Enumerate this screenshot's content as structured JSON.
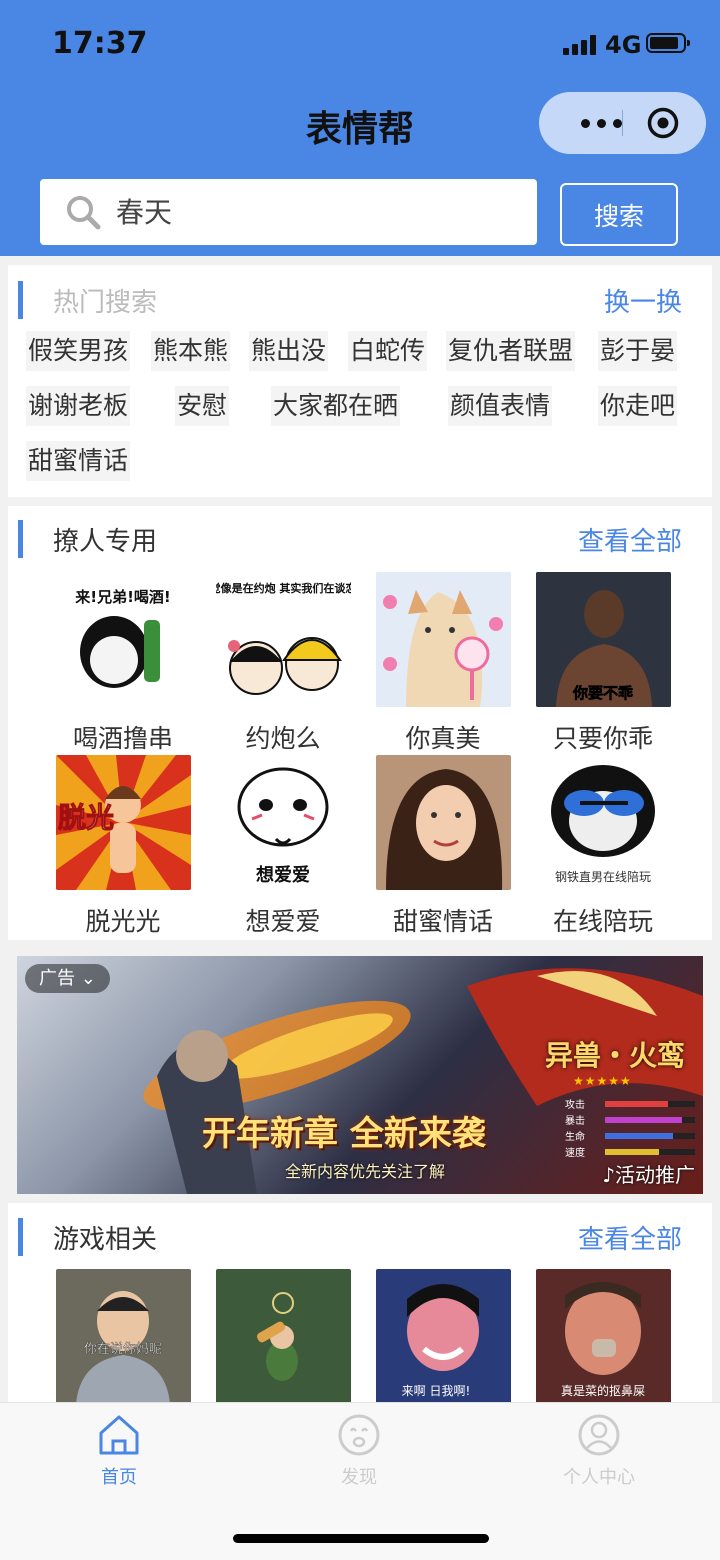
{
  "status_bar": {
    "time": "17:37",
    "network": "4G"
  },
  "app_title": "表情帮",
  "search": {
    "placeholder": "春天",
    "button_label": "搜索"
  },
  "hot_search": {
    "title": "热门搜索",
    "refresh_label": "换一换",
    "tags": [
      "假笑男孩",
      "熊本熊",
      "熊出没",
      "白蛇传",
      "复仇者联盟",
      "彭于晏",
      "谢谢老板",
      "安慰",
      "大家都在晒",
      "颜值表情",
      "你走吧",
      "甜蜜情话"
    ]
  },
  "flirt_section": {
    "title": "撩人专用",
    "view_all_label": "查看全部",
    "items": [
      {
        "label": "喝酒撸串",
        "overlay": "来!兄弟!喝酒!"
      },
      {
        "label": "约炮么",
        "overlay": "感觉像是在约炮 其实我们在谈恋爱"
      },
      {
        "label": "你真美",
        "overlay": ""
      },
      {
        "label": "只要你乖",
        "overlay": "你要不乖"
      },
      {
        "label": "脱光光",
        "overlay": "脱光"
      },
      {
        "label": "想爱爱",
        "overlay": "想爱爱"
      },
      {
        "label": "甜蜜情话",
        "overlay": ""
      },
      {
        "label": "在线陪玩",
        "overlay": "钢铁直男在线陪玩"
      }
    ]
  },
  "ad": {
    "badge": "广告",
    "headline": "开年新章 全新来袭",
    "subline": "全新内容优先关注了解",
    "game_name": "异兽・火鸾",
    "stars": "★★★★★",
    "stats": [
      {
        "label": "攻击",
        "level": 0.7,
        "color": "#e04040"
      },
      {
        "label": "暴击",
        "level": 0.85,
        "color": "#c040d0"
      },
      {
        "label": "生命",
        "level": 0.75,
        "color": "#4070e0"
      },
      {
        "label": "速度",
        "level": 0.6,
        "color": "#e0c030"
      }
    ],
    "promo_label": "活动推广"
  },
  "game_section": {
    "title": "游戏相关",
    "view_all_label": "查看全部",
    "items": [
      {
        "overlay": "你在说你妈呢"
      },
      {
        "overlay": ""
      },
      {
        "overlay": "来啊 日我啊!"
      },
      {
        "overlay": "真是菜的抠鼻屎"
      }
    ]
  },
  "tabbar": {
    "tabs": [
      {
        "label": "首页",
        "icon": "home-icon",
        "active": true
      },
      {
        "label": "发现",
        "icon": "discover-icon",
        "active": false
      },
      {
        "label": "个人中心",
        "icon": "profile-icon",
        "active": false
      }
    ],
    "active_color": "#4a86e4",
    "inactive_color": "#cccccc"
  },
  "colors": {
    "brand": "#4a86e4",
    "page_bg": "#f1f1f1"
  }
}
